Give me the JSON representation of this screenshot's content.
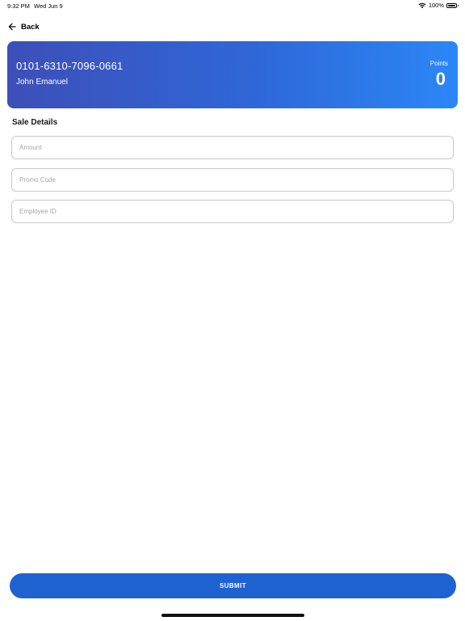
{
  "status_bar": {
    "time": "9:32 PM",
    "date": "Wed Jun 9",
    "battery": "100%",
    "battery_level": 1.0,
    "icons": [
      "wifi-icon",
      "battery-icon"
    ]
  },
  "nav": {
    "back_label": "Back",
    "back_icon": "arrow-left-icon"
  },
  "card": {
    "number": "0101-6310-7096-0661",
    "name": "John Emanuel",
    "points_label": "Points",
    "points_value": "0",
    "gradient_colors": [
      "#3d4fb8",
      "#2b87f6"
    ]
  },
  "form": {
    "title": "Sale Details",
    "amount_placeholder": "Amount",
    "promo_placeholder": "Promo Code",
    "employee_placeholder": "Employee ID",
    "amount_value": "",
    "promo_value": "",
    "employee_value": ""
  },
  "submit": {
    "label": "SUBMIT",
    "color": "#1d62d0"
  }
}
